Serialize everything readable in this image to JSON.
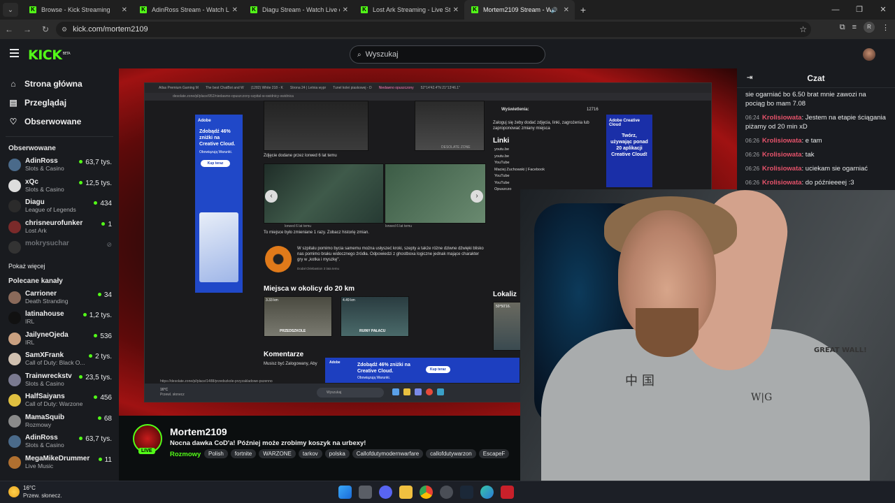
{
  "browser": {
    "tabs": [
      {
        "title": "Browse - Kick Streaming",
        "active": false
      },
      {
        "title": "AdinRoss Stream - Watch Live o",
        "active": false
      },
      {
        "title": "Diagu Stream - Watch Live on K",
        "active": false
      },
      {
        "title": "Lost Ark Streaming - Live Strea",
        "active": false
      },
      {
        "title": "Mortem2109 Stream - Watc",
        "active": true
      }
    ],
    "url": "kick.com/mortem2109",
    "profile_initial": "R",
    "new_tab": "+",
    "win_min": "—",
    "win_max": "❐",
    "win_close": "✕"
  },
  "header": {
    "logo": "KICK",
    "logo_badge": "BETA",
    "search_placeholder": "Wyszukaj"
  },
  "sidebar": {
    "nav": [
      {
        "label": "Strona główna",
        "icon": "home-icon"
      },
      {
        "label": "Przeglądaj",
        "icon": "browse-icon"
      },
      {
        "label": "Obserwowane",
        "icon": "heart-icon"
      }
    ],
    "followed_heading": "Obserwowane",
    "followed": [
      {
        "name": "AdinRoss",
        "category": "Slots & Casino",
        "viewers": "63,7 tys.",
        "color": "#4a6a8a"
      },
      {
        "name": "xQc",
        "category": "Slots & Casino",
        "viewers": "12,5 tys.",
        "color": "#dddddd"
      },
      {
        "name": "Diagu",
        "category": "League of Legends",
        "viewers": "434",
        "color": "#2b2b2b"
      },
      {
        "name": "chrisneurofunker",
        "category": "Lost Ark",
        "viewers": "1",
        "color": "#7a2a2a"
      },
      {
        "name": "mokrysuchar",
        "category": "",
        "viewers": "",
        "color": "#333333",
        "offline": true
      }
    ],
    "show_more": "Pokaż więcej",
    "recommended_heading": "Polecane kanały",
    "recommended": [
      {
        "name": "Carrioner",
        "category": "Death Stranding",
        "viewers": "34",
        "color": "#8a6a5a"
      },
      {
        "name": "latinahouse",
        "category": "IRL",
        "viewers": "1,2 tys.",
        "color": "#111111"
      },
      {
        "name": "JailyneOjeda",
        "category": "IRL",
        "viewers": "536",
        "color": "#c9a080"
      },
      {
        "name": "SamXFrank",
        "category": "Call of Duty: Black O...",
        "viewers": "2 tys.",
        "color": "#d0c0b0"
      },
      {
        "name": "Trainwreckstv",
        "category": "Slots & Casino",
        "viewers": "23,5 tys.",
        "color": "#7a7a90"
      },
      {
        "name": "HalfSaiyans",
        "category": "Call of Duty: Warzone",
        "viewers": "456",
        "color": "#e0c040"
      },
      {
        "name": "MamaSquib",
        "category": "Rozmowy",
        "viewers": "68",
        "color": "#8a8a8a"
      },
      {
        "name": "AdinRoss",
        "category": "Slots & Casino",
        "viewers": "63,7 tys.",
        "color": "#4a6a8a"
      },
      {
        "name": "MegaMikeDrummer",
        "category": "Live Music",
        "viewers": "11",
        "color": "#b07030"
      }
    ]
  },
  "video_inner": {
    "tabs": [
      "Atlas Premium Gaming M",
      "The best ChatBot and W",
      "(1282) White 218 - K",
      "Strona 24 | Letnia wypr",
      "Tunel kolei piaskowej - D",
      "Niedawno opuszczony",
      "52°14'42.4\"N 21°13'46.1\""
    ],
    "url": "desolate.zone/pl/place/952/niedawno-opuszczony-szpital-w-swidnicy-swidnica",
    "ad_left": {
      "brand": "Adobe",
      "text": "Zdobądź 46% zniżki na Creative Cloud.",
      "sub": "Obowiązują Warunki.",
      "cta": "Kup teraz"
    },
    "ad_right": {
      "brand": "Adobe Creative Cloud",
      "text": "Twórz, używając ponad 20 aplikacji Creative Cloud!"
    },
    "views_label": "Wyświetlenia:",
    "views_value": "12716",
    "login_note": "Zaloguj się żeby dodać zdjęcia, linki, zagrożenia lub zaproponować zmiany miejsca",
    "links_heading": "Linki",
    "links": [
      "youtu.be",
      "youtu.be",
      "YouTube",
      "Maciej Zuchowski | Facebook",
      "YouTube",
      "YouTube",
      "Opuszczo"
    ],
    "photo_caption": "Zdjęcie dodane przez lorwed 6 lat temu",
    "photo_credit_1": "lorwed 6 lat temu",
    "photo_credit_2": "lorwed 6 lat temu",
    "changed_note": "To miejsce było zmieniane 1 razy. Zobacz historię zmian.",
    "description": "W szpitalu pomimo bycia samemu można usłyszeć kroki, szepty a także różne dziwne dźwięki blisko nas pomimo braku widocznego źródła. Odpowiedzi z ghostboxa logiczne jednak mające charakter gry w „kotka i myszkę\".",
    "desc_author": "Dodał Cklebastion 3 lata temu",
    "nearby_heading": "Miejsca w okolicy do 20 km",
    "nearby": [
      {
        "dist": "3.33 km",
        "name": "PRZEDSZKOLE"
      },
      {
        "dist": "4.49 km",
        "name": "RUINY PAŁACU"
      }
    ],
    "comments_heading": "Komentarze",
    "comments_note": "Musisz być Zalogowany, Aby",
    "location_heading": "Lokaliz",
    "coords": "50°50'16.",
    "bottom_ad": {
      "brand": "Adobe",
      "text": "Zdobądź 46% zniżki na Creative Cloud.",
      "sub": "Obowiązują Warunki.",
      "cta": "Kup teraz"
    },
    "status_url": "https://desolate.zone/pl/place/1488/przedszkole-przyzakladowe-pszenno",
    "task_weather": "16°C",
    "task_weather_desc": "Przewl. słonecz",
    "task_search": "Wyszukaj",
    "watermark": "DESOLATE ZONE"
  },
  "cam": {
    "shirt_text": "中国",
    "shirt_text2": "W|G",
    "wall_text": "GREAT WALL!"
  },
  "chat": {
    "title": "Czat",
    "messages": [
      {
        "ts": "",
        "user": "",
        "text": "sie ogarniać bo 6.50 brat mnie zawozi na pociąg bo mam 7.08"
      },
      {
        "ts": "06:24",
        "user": "Krolisiowata",
        "text": ": Jestem na etapie ściągania piżamy od 20 min xD"
      },
      {
        "ts": "06:26",
        "user": "Krolisiowata",
        "text": ": e tam"
      },
      {
        "ts": "06:26",
        "user": "Krolisiowata",
        "text": ": tak"
      },
      {
        "ts": "06:26",
        "user": "Krolisiowata",
        "text": ": uciekam sie ogarniać"
      },
      {
        "ts": "06:26",
        "user": "Krolisiowata",
        "text": ": do późnieeeej :3"
      }
    ]
  },
  "stream": {
    "streamer": "Mortem2109",
    "live_label": "LIVE",
    "title": "Nocna dawka CoD'a! Później może zrobimy koszyk na urbexy!",
    "category": "Rozmowy",
    "tags": [
      "Polish",
      "fortnite",
      "WARZONE",
      "tarkov",
      "polska",
      "Callofdutymodernwarfare",
      "callofdutywarzon",
      "EscapeF"
    ]
  },
  "os_taskbar": {
    "temp": "16°C",
    "weather": "Przew. słonecz."
  },
  "colors": {
    "kick_green": "#53fc18",
    "chat_user": "#e6536b",
    "bg_dark": "#0b0e0f",
    "panel": "#191b1f"
  }
}
